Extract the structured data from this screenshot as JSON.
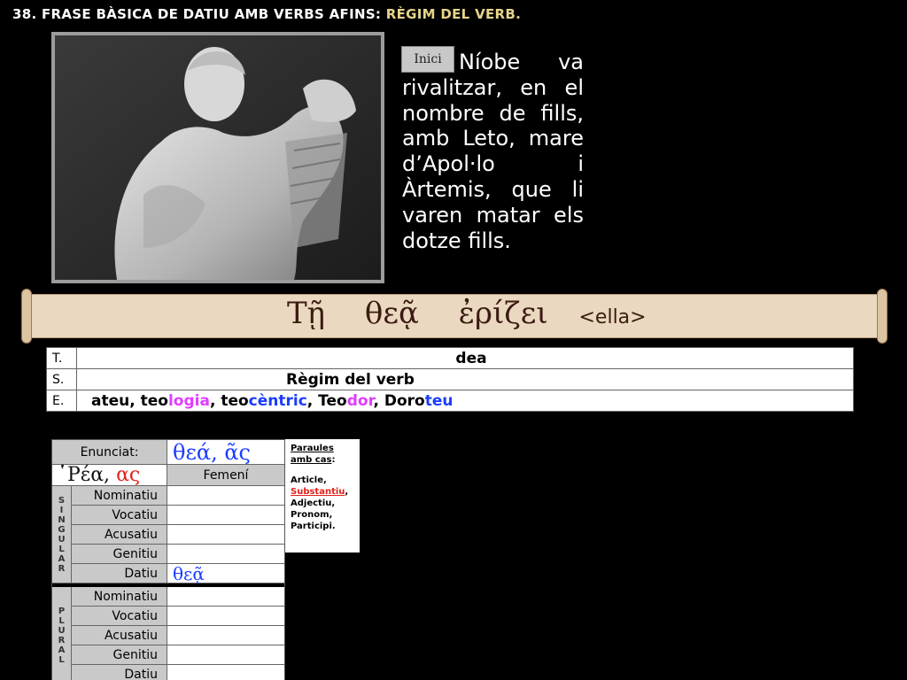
{
  "title": {
    "main": "38. FRASE BÀSICA DE DATIU AMB VERBS AFINS:",
    "highlight": "RÈGIM DEL VERB."
  },
  "start_button": {
    "label": "Inici"
  },
  "story": {
    "first_line": "Níobe va",
    "rest": "rivalitzar, en el nombre de fills, amb Leto, mare d’Apol·lo i Àrtemis, que li varen matar els dotze fills."
  },
  "greek_sentence": {
    "word1": "Τῇ",
    "word2": "θεᾷ",
    "word3": "ἐρίζει",
    "pronoun": "<ella>"
  },
  "tse_table": {
    "t_label": "T.",
    "t_value": "dea",
    "s_label": "S.",
    "s_value": "Règim del verb",
    "e_label": "E.",
    "e_parts": [
      "ateu",
      ", teo",
      "logia",
      ", teo",
      "cèntric",
      ", Teo",
      "dor",
      ", Doro",
      "teu"
    ]
  },
  "declension": {
    "enunciat_label": "Enunciat:",
    "enunciat_value": "θεά, ᾶς",
    "model_word": "῾Ρέα,",
    "model_ending": "ας",
    "gender": "Femení",
    "singular_label": [
      "S",
      "I",
      "N",
      "G",
      "U",
      "L",
      "A",
      "R"
    ],
    "plural_label": [
      "P",
      "L",
      "U",
      "R",
      "A",
      "L"
    ],
    "cases": [
      "Nominatiu",
      "Vocatiu",
      "Acusatiu",
      "Genitiu",
      "Datiu"
    ],
    "singular_values": [
      "",
      "",
      "",
      "",
      "θεᾷ"
    ],
    "plural_values": [
      "",
      "",
      "",
      "",
      ""
    ]
  },
  "words_box": {
    "heading": "Paraules amb cas",
    "colon": ":",
    "items": [
      "Article,",
      "Substantiu",
      ",",
      "Adjectiu,",
      "Pronom,",
      "Participi."
    ]
  }
}
